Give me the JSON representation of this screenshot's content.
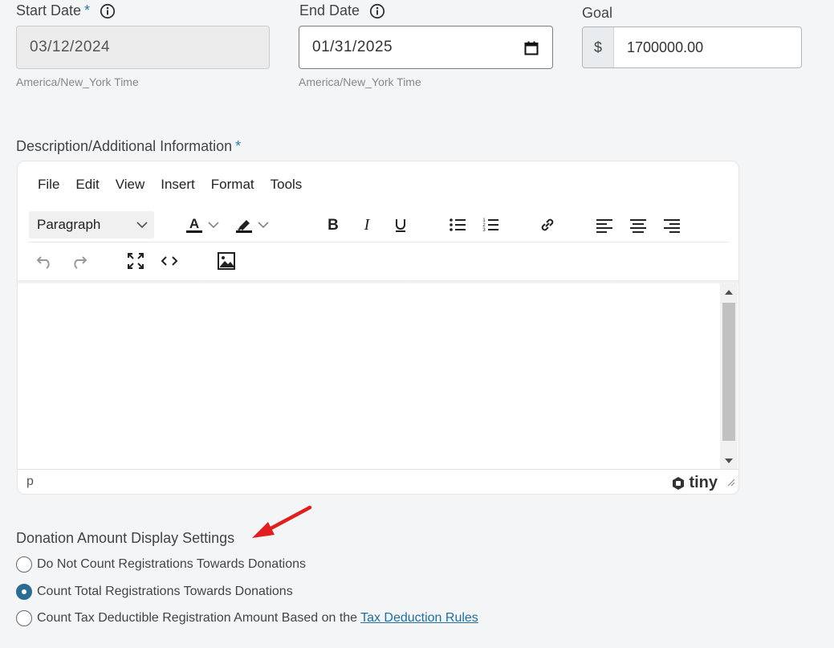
{
  "start_date": {
    "label": "Start Date",
    "required_mark": "*",
    "value": "03/12/2024",
    "timezone": "America/New_York Time",
    "info_icon": "info-icon"
  },
  "end_date": {
    "label": "End Date",
    "value": "01/31/2025",
    "timezone": "America/New_York Time",
    "info_icon": "info-icon",
    "calendar_icon": "calendar-icon"
  },
  "goal": {
    "label": "Goal",
    "prefix": "$",
    "value": "1700000.00"
  },
  "description": {
    "label": "Description/Additional Information",
    "required_mark": "*",
    "menus": [
      "File",
      "Edit",
      "View",
      "Insert",
      "Format",
      "Tools"
    ],
    "block_format": "Paragraph",
    "status_path": "p",
    "brand": "tiny"
  },
  "donation_settings": {
    "title": "Donation Amount Display Settings",
    "options": [
      {
        "label": "Do Not Count Registrations Towards Donations",
        "checked": false
      },
      {
        "label": "Count Total Registrations Towards Donations",
        "checked": true
      },
      {
        "label": "Count Tax Deductible Registration Amount Based on the",
        "link": "Tax Deduction Rules",
        "checked": false
      }
    ]
  },
  "colors": {
    "accent": "#2c6c93",
    "required": "#2e7ea3",
    "arrow": "#e02020"
  }
}
